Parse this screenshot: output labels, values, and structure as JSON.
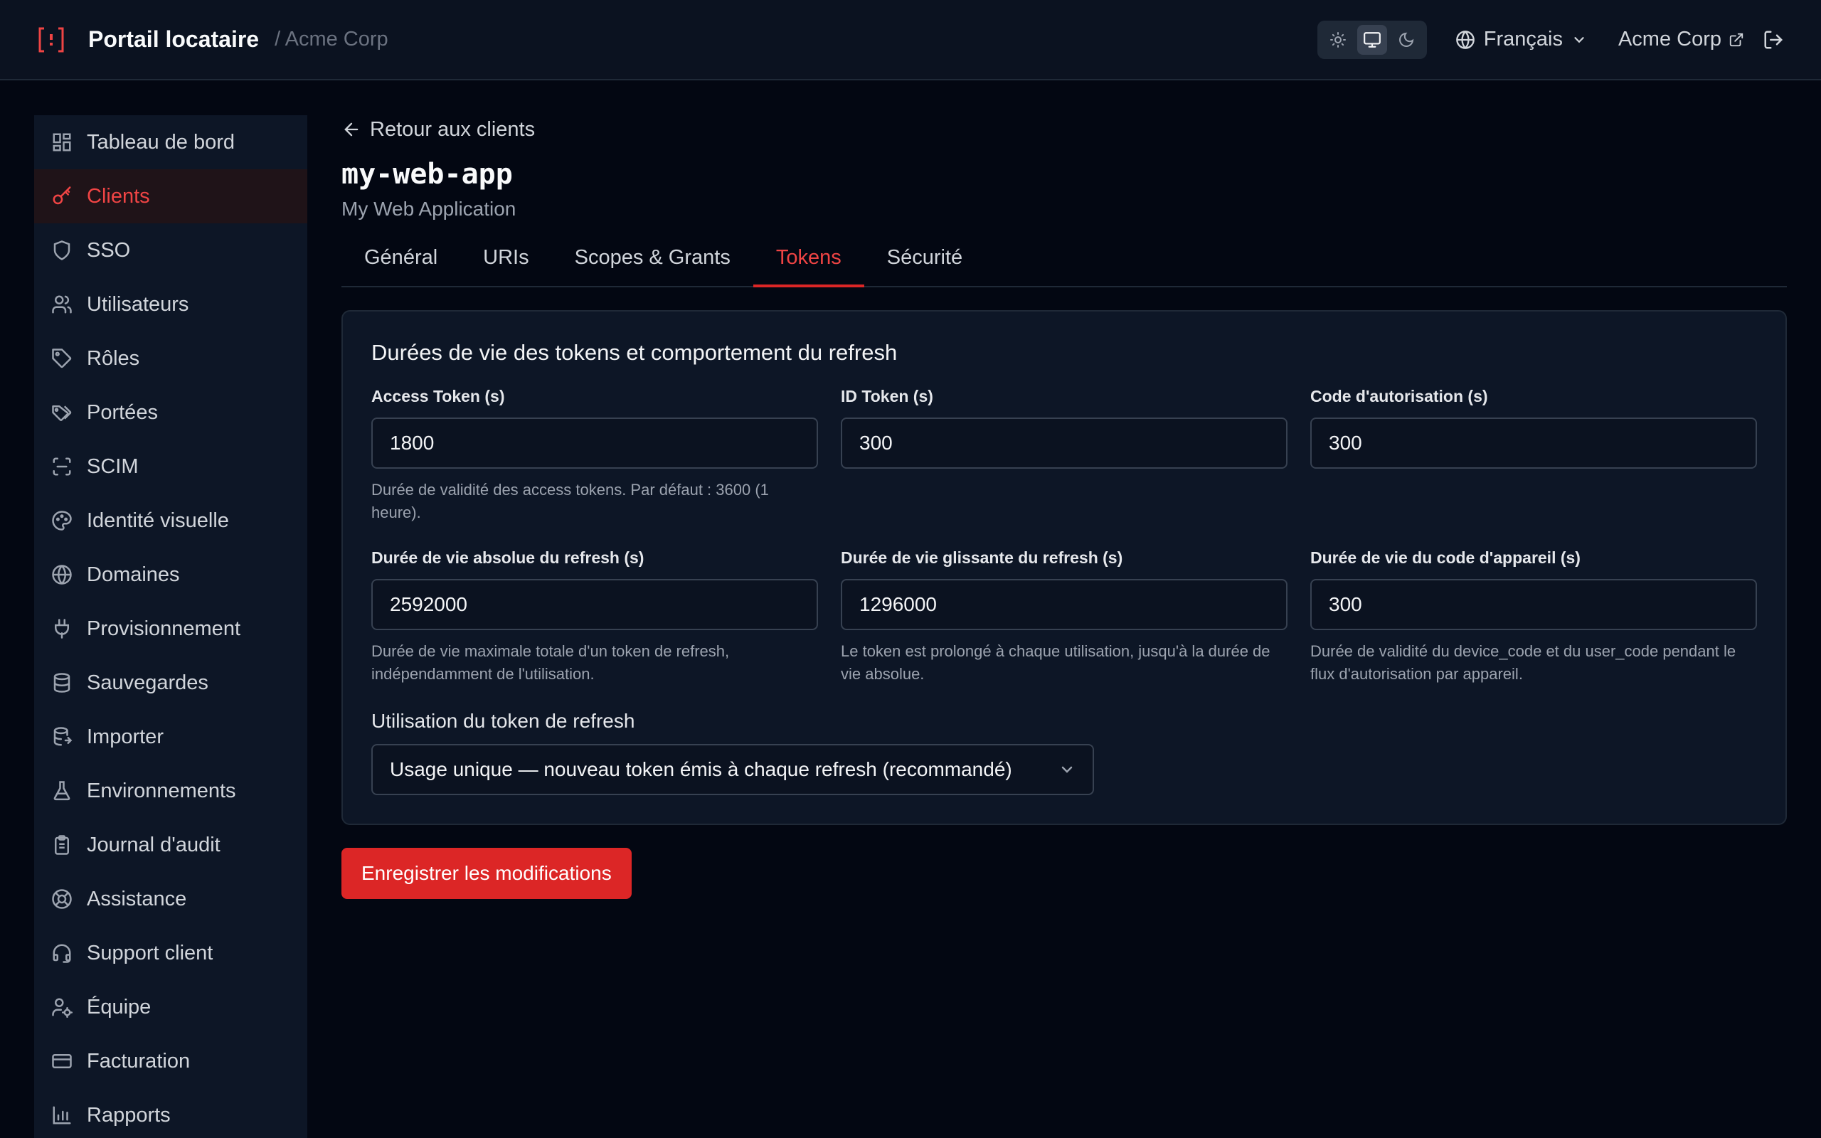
{
  "header": {
    "title": "Portail locataire",
    "org_crumb": "/ Acme Corp",
    "language": "Français",
    "org_link": "Acme Corp"
  },
  "sidebar": {
    "items": [
      {
        "label": "Tableau de bord",
        "icon": "dashboard-icon"
      },
      {
        "label": "Clients",
        "icon": "key-icon"
      },
      {
        "label": "SSO",
        "icon": "shield-icon"
      },
      {
        "label": "Utilisateurs",
        "icon": "users-icon"
      },
      {
        "label": "Rôles",
        "icon": "tag-icon"
      },
      {
        "label": "Portées",
        "icon": "tags-icon"
      },
      {
        "label": "SCIM",
        "icon": "scan-icon"
      },
      {
        "label": "Identité visuelle",
        "icon": "palette-icon"
      },
      {
        "label": "Domaines",
        "icon": "globe-icon"
      },
      {
        "label": "Provisionnement",
        "icon": "plug-icon"
      },
      {
        "label": "Sauvegardes",
        "icon": "database-icon"
      },
      {
        "label": "Importer",
        "icon": "database-import-icon"
      },
      {
        "label": "Environnements",
        "icon": "flask-icon"
      },
      {
        "label": "Journal d'audit",
        "icon": "clipboard-icon"
      },
      {
        "label": "Assistance",
        "icon": "lifebuoy-icon"
      },
      {
        "label": "Support client",
        "icon": "headset-icon"
      },
      {
        "label": "Équipe",
        "icon": "user-cog-icon"
      },
      {
        "label": "Facturation",
        "icon": "credit-card-icon"
      },
      {
        "label": "Rapports",
        "icon": "bar-chart-icon"
      }
    ],
    "active_index": 1
  },
  "main": {
    "back_label": "Retour aux clients",
    "title": "my-web-app",
    "subtitle": "My Web Application",
    "tabs": [
      "Général",
      "URIs",
      "Scopes & Grants",
      "Tokens",
      "Sécurité"
    ],
    "active_tab": 3,
    "card": {
      "title": "Durées de vie des tokens et comportement du refresh",
      "fields": [
        {
          "label": "Access Token (s)",
          "value": "1800",
          "hint": "Durée de validité des access tokens. Par défaut : 3600 (1 heure)."
        },
        {
          "label": "ID Token (s)",
          "value": "300",
          "hint": ""
        },
        {
          "label": "Code d'autorisation (s)",
          "value": "300",
          "hint": ""
        },
        {
          "label": "Durée de vie absolue du refresh (s)",
          "value": "2592000",
          "hint": "Durée de vie maximale totale d'un token de refresh, indépendamment de l'utilisation."
        },
        {
          "label": "Durée de vie glissante du refresh (s)",
          "value": "1296000",
          "hint": "Le token est prolongé à chaque utilisation, jusqu'à la durée de vie absolue."
        },
        {
          "label": "Durée de vie du code d'appareil (s)",
          "value": "300",
          "hint": "Durée de validité du device_code et du user_code pendant le flux d'autorisation par appareil."
        }
      ],
      "refresh_usage_label": "Utilisation du token de refresh",
      "refresh_usage_value": "Usage unique — nouveau token émis à chaque refresh (recommandé)"
    },
    "save_label": "Enregistrer les modifications"
  },
  "colors": {
    "accent": "#dc2626",
    "background": "#030712",
    "surface": "#0d1626"
  }
}
